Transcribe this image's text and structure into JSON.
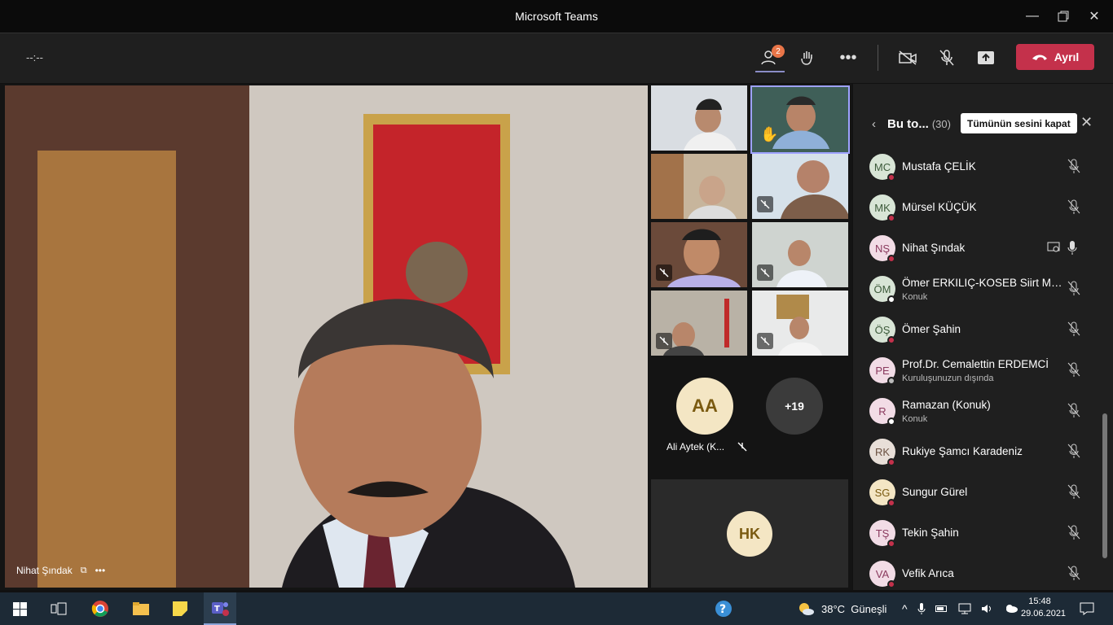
{
  "window": {
    "title": "Microsoft Teams"
  },
  "toolbar": {
    "timer": "--:--",
    "participants_badge": "2",
    "leave_label": "Ayrıl"
  },
  "main_video": {
    "name": "Nihat Şındak"
  },
  "tiles_extra": {
    "avatar1_initials": "AA",
    "avatar1_name": "Ali Aytek (K...",
    "more_label": "+19",
    "avatar2_initials": "HK"
  },
  "roster": {
    "title": "Bu to...",
    "count": "(30)",
    "mute_all": "Tümünün sesini kapat",
    "items": [
      {
        "initials": "MC",
        "name": "Mustafa ÇELİK",
        "sub": "",
        "avatar_bg": "#d8e5d6",
        "avatar_fg": "#3c5a3a"
      },
      {
        "initials": "MK",
        "name": "Mürsel KÜÇÜK",
        "sub": "",
        "avatar_bg": "#d8e5d6",
        "avatar_fg": "#3c5a3a"
      },
      {
        "initials": "NŞ",
        "name": "Nihat Şındak",
        "sub": "",
        "avatar_bg": "#f2dce6",
        "avatar_fg": "#8a3a5e"
      },
      {
        "initials": "ÖM",
        "name": "Ömer ERKILIÇ-KOSEB Siirt Mü...",
        "sub": "Konuk",
        "avatar_bg": "#d8e5d6",
        "avatar_fg": "#3c5a3a"
      },
      {
        "initials": "ÖŞ",
        "name": "Ömer Şahin",
        "sub": "",
        "avatar_bg": "#d8e5d6",
        "avatar_fg": "#3c5a3a"
      },
      {
        "initials": "PE",
        "name": "Prof.Dr. Cemalettin ERDEMCİ",
        "sub": "Kuruluşunuzun dışında",
        "avatar_bg": "#f2dce6",
        "avatar_fg": "#8a3a5e"
      },
      {
        "initials": "R",
        "name": "Ramazan (Konuk)",
        "sub": "Konuk",
        "avatar_bg": "#f2dce6",
        "avatar_fg": "#8a3a5e"
      },
      {
        "initials": "RK",
        "name": "Rukiye Şamcı Karadeniz",
        "sub": "",
        "avatar_bg": "#e8dfd8",
        "avatar_fg": "#6a5040"
      },
      {
        "initials": "SG",
        "name": "Sungur Gürel",
        "sub": "",
        "avatar_bg": "#f4e6c4",
        "avatar_fg": "#7a5a10"
      },
      {
        "initials": "TŞ",
        "name": "Tekin Şahin",
        "sub": "",
        "avatar_bg": "#f2dce6",
        "avatar_fg": "#8a3a5e"
      },
      {
        "initials": "VA",
        "name": "Vefik Arıca",
        "sub": "",
        "avatar_bg": "#f2dce6",
        "avatar_fg": "#8a3a5e"
      }
    ]
  },
  "taskbar": {
    "weather": "38°C  Güneşli",
    "time": "15:48",
    "date": "29.06.2021"
  }
}
